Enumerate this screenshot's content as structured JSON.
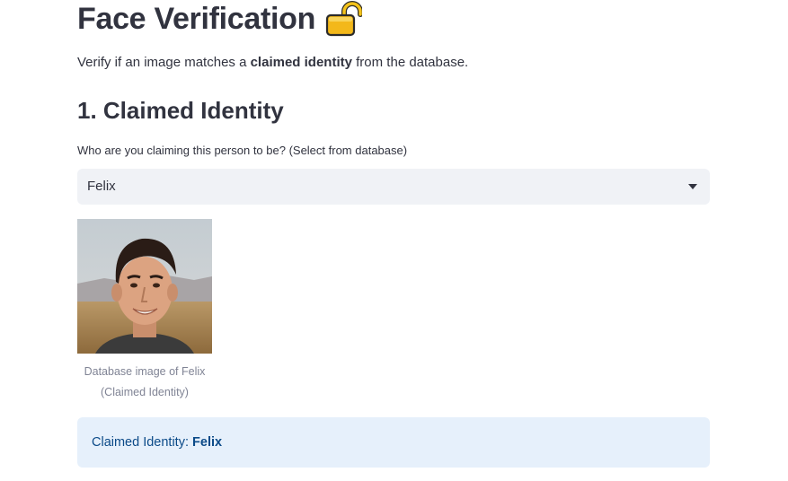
{
  "header": {
    "title": "Face Verification",
    "title_icon": "lock-icon"
  },
  "intro": {
    "prefix": "Verify if an image matches a ",
    "emphasis": "claimed identity",
    "suffix": " from the database."
  },
  "section": {
    "heading": "1. Claimed Identity"
  },
  "identity_select": {
    "label": "Who are you claiming this person to be? (Select from database)",
    "value": "Felix",
    "icon": "chevron-down-icon"
  },
  "database_image": {
    "alt": "Database image of Felix",
    "caption_line1": "Database image of Felix",
    "caption_line2": "(Claimed Identity)"
  },
  "info": {
    "label": "Claimed Identity: ",
    "value": "Felix"
  },
  "colors": {
    "text": "#31333f",
    "select_bg": "#f0f2f6",
    "info_bg": "#e6f0fb",
    "info_text": "#0b4a88",
    "caption": "#808495"
  }
}
